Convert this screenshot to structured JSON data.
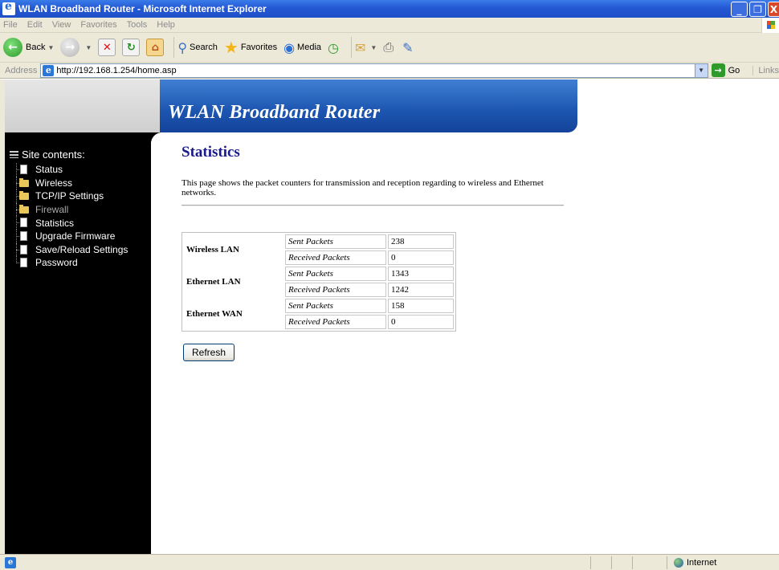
{
  "window": {
    "title": "WLAN Broadband Router - Microsoft Internet Explorer",
    "minimize": "_",
    "maximize": "❐",
    "close": "X"
  },
  "menu": [
    "File",
    "Edit",
    "View",
    "Favorites",
    "Tools",
    "Help"
  ],
  "toolbar": {
    "back": "Back",
    "search": "Search",
    "favorites": "Favorites",
    "media": "Media"
  },
  "address": {
    "label": "Address",
    "url": "http://192.168.1.254/home.asp",
    "go": "Go",
    "links": "Links"
  },
  "banner": {
    "title": "WLAN Broadband Router"
  },
  "sidebar": {
    "title": "Site contents:",
    "items": [
      {
        "label": "Status",
        "icon": "document-icon"
      },
      {
        "label": "Wireless",
        "icon": "folder-icon"
      },
      {
        "label": "TCP/IP Settings",
        "icon": "folder-icon"
      },
      {
        "label": "Firewall",
        "icon": "folder-icon"
      },
      {
        "label": "Statistics",
        "icon": "document-icon"
      },
      {
        "label": "Upgrade Firmware",
        "icon": "document-icon"
      },
      {
        "label": "Save/Reload Settings",
        "icon": "document-icon"
      },
      {
        "label": "Password",
        "icon": "document-icon"
      }
    ]
  },
  "page": {
    "title": "Statistics",
    "description": "This page shows the packet counters for transmission and reception regarding to wireless and Ethernet networks.",
    "refresh": "Refresh"
  },
  "stats": [
    {
      "name": "Wireless LAN",
      "sent_label": "Sent Packets",
      "sent": "238",
      "recv_label": "Received Packets",
      "recv": "0"
    },
    {
      "name": "Ethernet LAN",
      "sent_label": "Sent Packets",
      "sent": "1343",
      "recv_label": "Received Packets",
      "recv": "1242"
    },
    {
      "name": "Ethernet WAN",
      "sent_label": "Sent Packets",
      "sent": "158",
      "recv_label": "Received Packets",
      "recv": "0"
    }
  ],
  "status": {
    "zone": "Internet"
  }
}
